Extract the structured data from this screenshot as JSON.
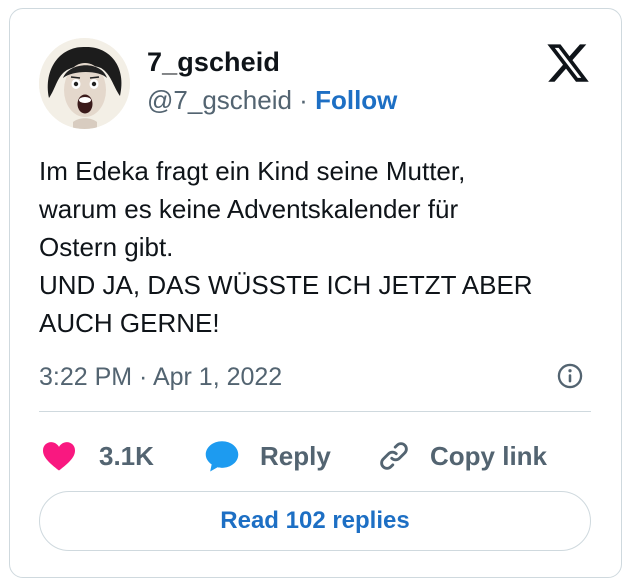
{
  "user": {
    "display_name": "7_gscheid",
    "handle": "@7_gscheid",
    "separator": "·",
    "follow_label": "Follow"
  },
  "tweet": {
    "lines": [
      "Im Edeka fragt ein Kind seine Mutter,",
      "warum es keine Adventskalender für",
      "Ostern gibt.",
      "UND JA, DAS WÜSSTE ICH JETZT ABER",
      "AUCH GERNE!"
    ],
    "timestamp": "3:22 PM · Apr 1, 2022"
  },
  "actions": {
    "likes": "3.1K",
    "reply_label": "Reply",
    "copy_link_label": "Copy link"
  },
  "read_replies_label": "Read 102 replies",
  "icons": {
    "brand": "x-logo-icon",
    "like": "heart-icon",
    "reply": "speech-bubble-icon",
    "copy": "link-icon",
    "info": "info-icon"
  },
  "colors": {
    "like": "#f91880",
    "reply": "#1d9bf0",
    "link": "#1d6fc4",
    "muted": "#536471",
    "text": "#0f1419"
  }
}
